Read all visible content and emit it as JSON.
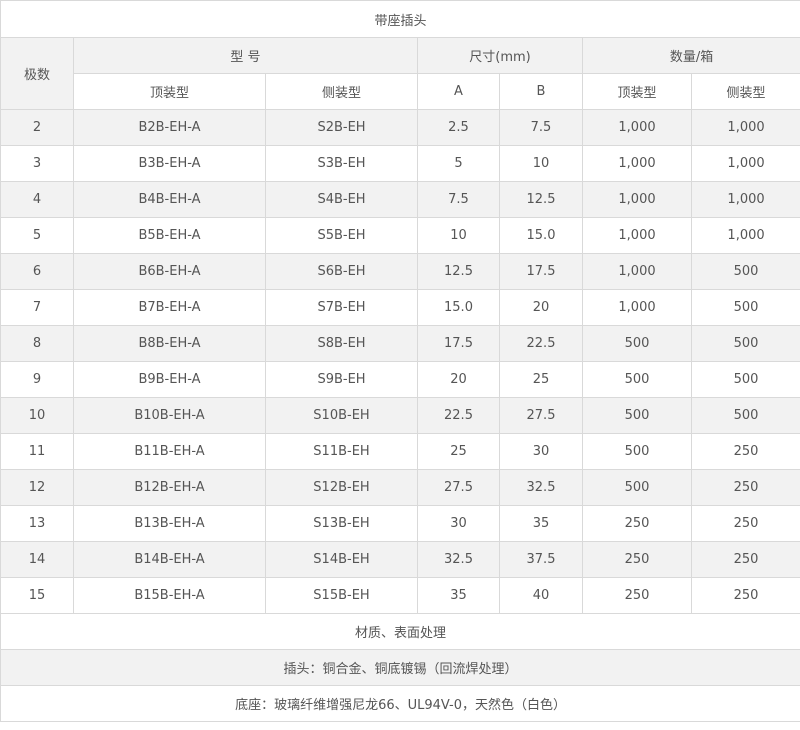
{
  "table": {
    "title": "带座插头",
    "headers": {
      "poles": "极数",
      "model": "型 号",
      "size": "尺寸(mm)",
      "qty": "数量/箱",
      "top_model": "顶装型",
      "side_model": "侧装型",
      "a": "A",
      "b": "B",
      "top_qty": "顶装型",
      "side_qty": "侧装型"
    },
    "rows": [
      {
        "poles": "2",
        "top": "B2B-EH-A",
        "side": "S2B-EH",
        "a": "2.5",
        "b": "7.5",
        "qty_top": "1,000",
        "qty_side": "1,000"
      },
      {
        "poles": "3",
        "top": "B3B-EH-A",
        "side": "S3B-EH",
        "a": "5",
        "b": "10",
        "qty_top": "1,000",
        "qty_side": "1,000"
      },
      {
        "poles": "4",
        "top": "B4B-EH-A",
        "side": "S4B-EH",
        "a": "7.5",
        "b": "12.5",
        "qty_top": "1,000",
        "qty_side": "1,000"
      },
      {
        "poles": "5",
        "top": "B5B-EH-A",
        "side": "S5B-EH",
        "a": "10",
        "b": "15.0",
        "qty_top": "1,000",
        "qty_side": "1,000"
      },
      {
        "poles": "6",
        "top": "B6B-EH-A",
        "side": "S6B-EH",
        "a": "12.5",
        "b": "17.5",
        "qty_top": "1,000",
        "qty_side": "500"
      },
      {
        "poles": "7",
        "top": "B7B-EH-A",
        "side": "S7B-EH",
        "a": "15.0",
        "b": "20",
        "qty_top": "1,000",
        "qty_side": "500"
      },
      {
        "poles": "8",
        "top": "B8B-EH-A",
        "side": "S8B-EH",
        "a": "17.5",
        "b": "22.5",
        "qty_top": "500",
        "qty_side": "500"
      },
      {
        "poles": "9",
        "top": "B9B-EH-A",
        "side": "S9B-EH",
        "a": "20",
        "b": "25",
        "qty_top": "500",
        "qty_side": "500"
      },
      {
        "poles": "10",
        "top": "B10B-EH-A",
        "side": "S10B-EH",
        "a": "22.5",
        "b": "27.5",
        "qty_top": "500",
        "qty_side": "500"
      },
      {
        "poles": "11",
        "top": "B11B-EH-A",
        "side": "S11B-EH",
        "a": "25",
        "b": "30",
        "qty_top": "500",
        "qty_side": "250"
      },
      {
        "poles": "12",
        "top": "B12B-EH-A",
        "side": "S12B-EH",
        "a": "27.5",
        "b": "32.5",
        "qty_top": "500",
        "qty_side": "250"
      },
      {
        "poles": "13",
        "top": "B13B-EH-A",
        "side": "S13B-EH",
        "a": "30",
        "b": "35",
        "qty_top": "250",
        "qty_side": "250"
      },
      {
        "poles": "14",
        "top": "B14B-EH-A",
        "side": "S14B-EH",
        "a": "32.5",
        "b": "37.5",
        "qty_top": "250",
        "qty_side": "250"
      },
      {
        "poles": "15",
        "top": "B15B-EH-A",
        "side": "S15B-EH",
        "a": "35",
        "b": "40",
        "qty_top": "250",
        "qty_side": "250"
      }
    ],
    "footer": {
      "material_title": "材质、表面处理",
      "plug": "插头：铜合金、铜底镀锡（回流焊处理）",
      "base": "底座：玻璃纤维增强尼龙66、UL94V-0，天然色（白色）"
    }
  }
}
